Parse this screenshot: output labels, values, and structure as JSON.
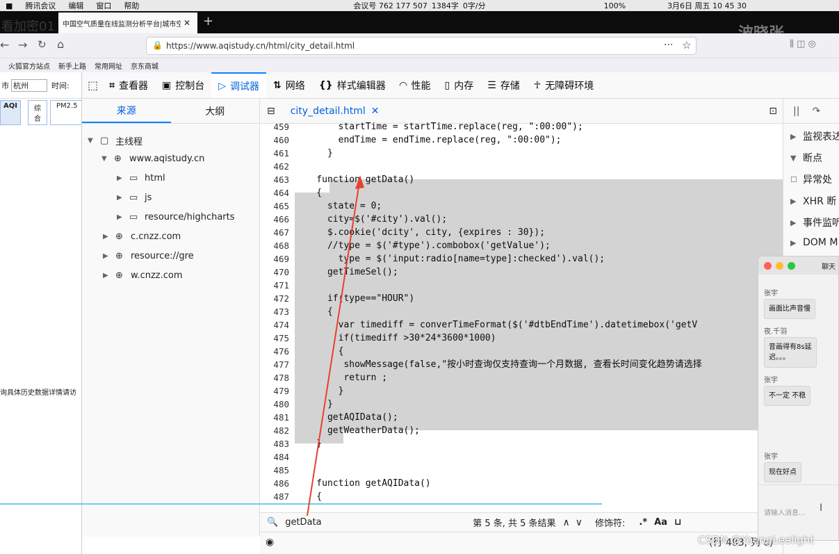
{
  "menubar": {
    "items": [
      "腾讯会议",
      "编辑",
      "窗口",
      "帮助"
    ],
    "meeting_id": "会议号 762 177 507",
    "counter": "1384字",
    "rate": "0字/分",
    "battery": "100%",
    "datetime": "3月6日 周五 10 45 30"
  },
  "browser": {
    "tab_title": "中国空气质量在线监测分析平台|城市空",
    "url": "https://www.aqistudy.cn/html/city_detail.html",
    "watermark_left": "看加密01",
    "watermark_right": "波晓张",
    "bookmarks": [
      "火狐官方站点",
      "新手上路",
      "常用网址",
      "京东商城"
    ]
  },
  "page_left": {
    "city_label": "市",
    "city_value": "杭州",
    "time_label": "时间:",
    "tabs": [
      "AQI",
      "综合",
      "PM2.5"
    ],
    "hint": "询具体历史数据详情请访"
  },
  "devtools": {
    "tabs": [
      "查看器",
      "控制台",
      "调试器",
      "网络",
      "样式编辑器",
      "性能",
      "内存",
      "存储",
      "无障碍环境"
    ],
    "active_tab": "调试器",
    "sources_tabs": [
      "来源",
      "大纲"
    ],
    "tree": [
      {
        "label": "主线程",
        "arrow": "▼",
        "icon": "frame"
      },
      {
        "label": "www.aqistudy.cn",
        "arrow": "▼",
        "icon": "globe"
      },
      {
        "label": "html",
        "arrow": "▶",
        "icon": "folder"
      },
      {
        "label": "js",
        "arrow": "▶",
        "icon": "folder"
      },
      {
        "label": "resource/highcharts",
        "arrow": "▶",
        "icon": "folder"
      },
      {
        "label": "c.cnzz.com",
        "arrow": "▶",
        "icon": "globe"
      },
      {
        "label": "resource://gre",
        "arrow": "▶",
        "icon": "globe"
      },
      {
        "label": "w.cnzz.com",
        "arrow": "▶",
        "icon": "globe"
      }
    ],
    "editor_tab": "city_detail.html",
    "code_lines": [
      {
        "n": "459",
        "t": "        startTime = startTime.replace(reg, \":00:00\");"
      },
      {
        "n": "460",
        "t": "        endTime = endTime.replace(reg, \":00:00\");"
      },
      {
        "n": "461",
        "t": "      }"
      },
      {
        "n": "462",
        "t": ""
      },
      {
        "n": "463",
        "t": "    function getData()"
      },
      {
        "n": "464",
        "t": "    {"
      },
      {
        "n": "465",
        "t": "      state = 0;"
      },
      {
        "n": "466",
        "t": "      city=$('#city').val();"
      },
      {
        "n": "467",
        "t": "      $.cookie('dcity', city, {expires : 30});"
      },
      {
        "n": "468",
        "t": "      //type = $('#type').combobox('getValue');"
      },
      {
        "n": "469",
        "t": "        type = $('input:radio[name=type]:checked').val();"
      },
      {
        "n": "470",
        "t": "      getTimeSel();"
      },
      {
        "n": "471",
        "t": ""
      },
      {
        "n": "472",
        "t": "      if(type==\"HOUR\")"
      },
      {
        "n": "473",
        "t": "      {"
      },
      {
        "n": "474",
        "t": "        var timediff = converTimeFormat($('#dtbEndTime').datetimebox('getV"
      },
      {
        "n": "475",
        "t": "        if(timediff >30*24*3600*1000)"
      },
      {
        "n": "476",
        "t": "        {"
      },
      {
        "n": "477",
        "t": "         showMessage(false,\"按小时查询仅支持查询一个月数据, 查看长时间变化趋势请选择"
      },
      {
        "n": "478",
        "t": "         return ;"
      },
      {
        "n": "479",
        "t": "        }"
      },
      {
        "n": "480",
        "t": "      }"
      },
      {
        "n": "481",
        "t": "      getAQIData();"
      },
      {
        "n": "482",
        "t": "      getWeatherData();"
      },
      {
        "n": "483",
        "t": "    }"
      },
      {
        "n": "484",
        "t": ""
      },
      {
        "n": "485",
        "t": ""
      },
      {
        "n": "486",
        "t": "    function getAQIData()"
      },
      {
        "n": "487",
        "t": "    {"
      }
    ],
    "search_value": "getData",
    "search_result": "第 5 条, 共 5 条结果",
    "modifier_label": "修饰符:",
    "regex_glyph": ".*",
    "case_glyph": "Aa",
    "status_text": "(行 483, 列 6)",
    "right_panel": [
      {
        "arrow": "▶",
        "label": "监视表达"
      },
      {
        "arrow": "▼",
        "label": "断点"
      },
      {
        "arrow": "☐",
        "label": "异常处"
      },
      {
        "arrow": "▶",
        "label": "XHR 断"
      },
      {
        "arrow": "▶",
        "label": "事件监听"
      },
      {
        "arrow": "▶",
        "label": "DOM M"
      }
    ]
  },
  "chat": {
    "title": "聊天",
    "messages": [
      {
        "sender": "张宇",
        "text": "画面比声音慢"
      },
      {
        "sender": "夜.千羽",
        "text": "音画得有8s延迟。。。"
      },
      {
        "sender": "张宇",
        "text": "不一定 不稳"
      },
      {
        "sender": "张宇",
        "text": "现在好点"
      }
    ],
    "input_placeholder": "请输入消息..."
  },
  "watermark": "CSDN @YoungLeelight",
  "colors": {
    "accent": "#0a84ff",
    "highlight": "#d3d3d3",
    "annotation": "#e8402f",
    "keyword": "#dd00a9",
    "function": "#0074e8"
  }
}
